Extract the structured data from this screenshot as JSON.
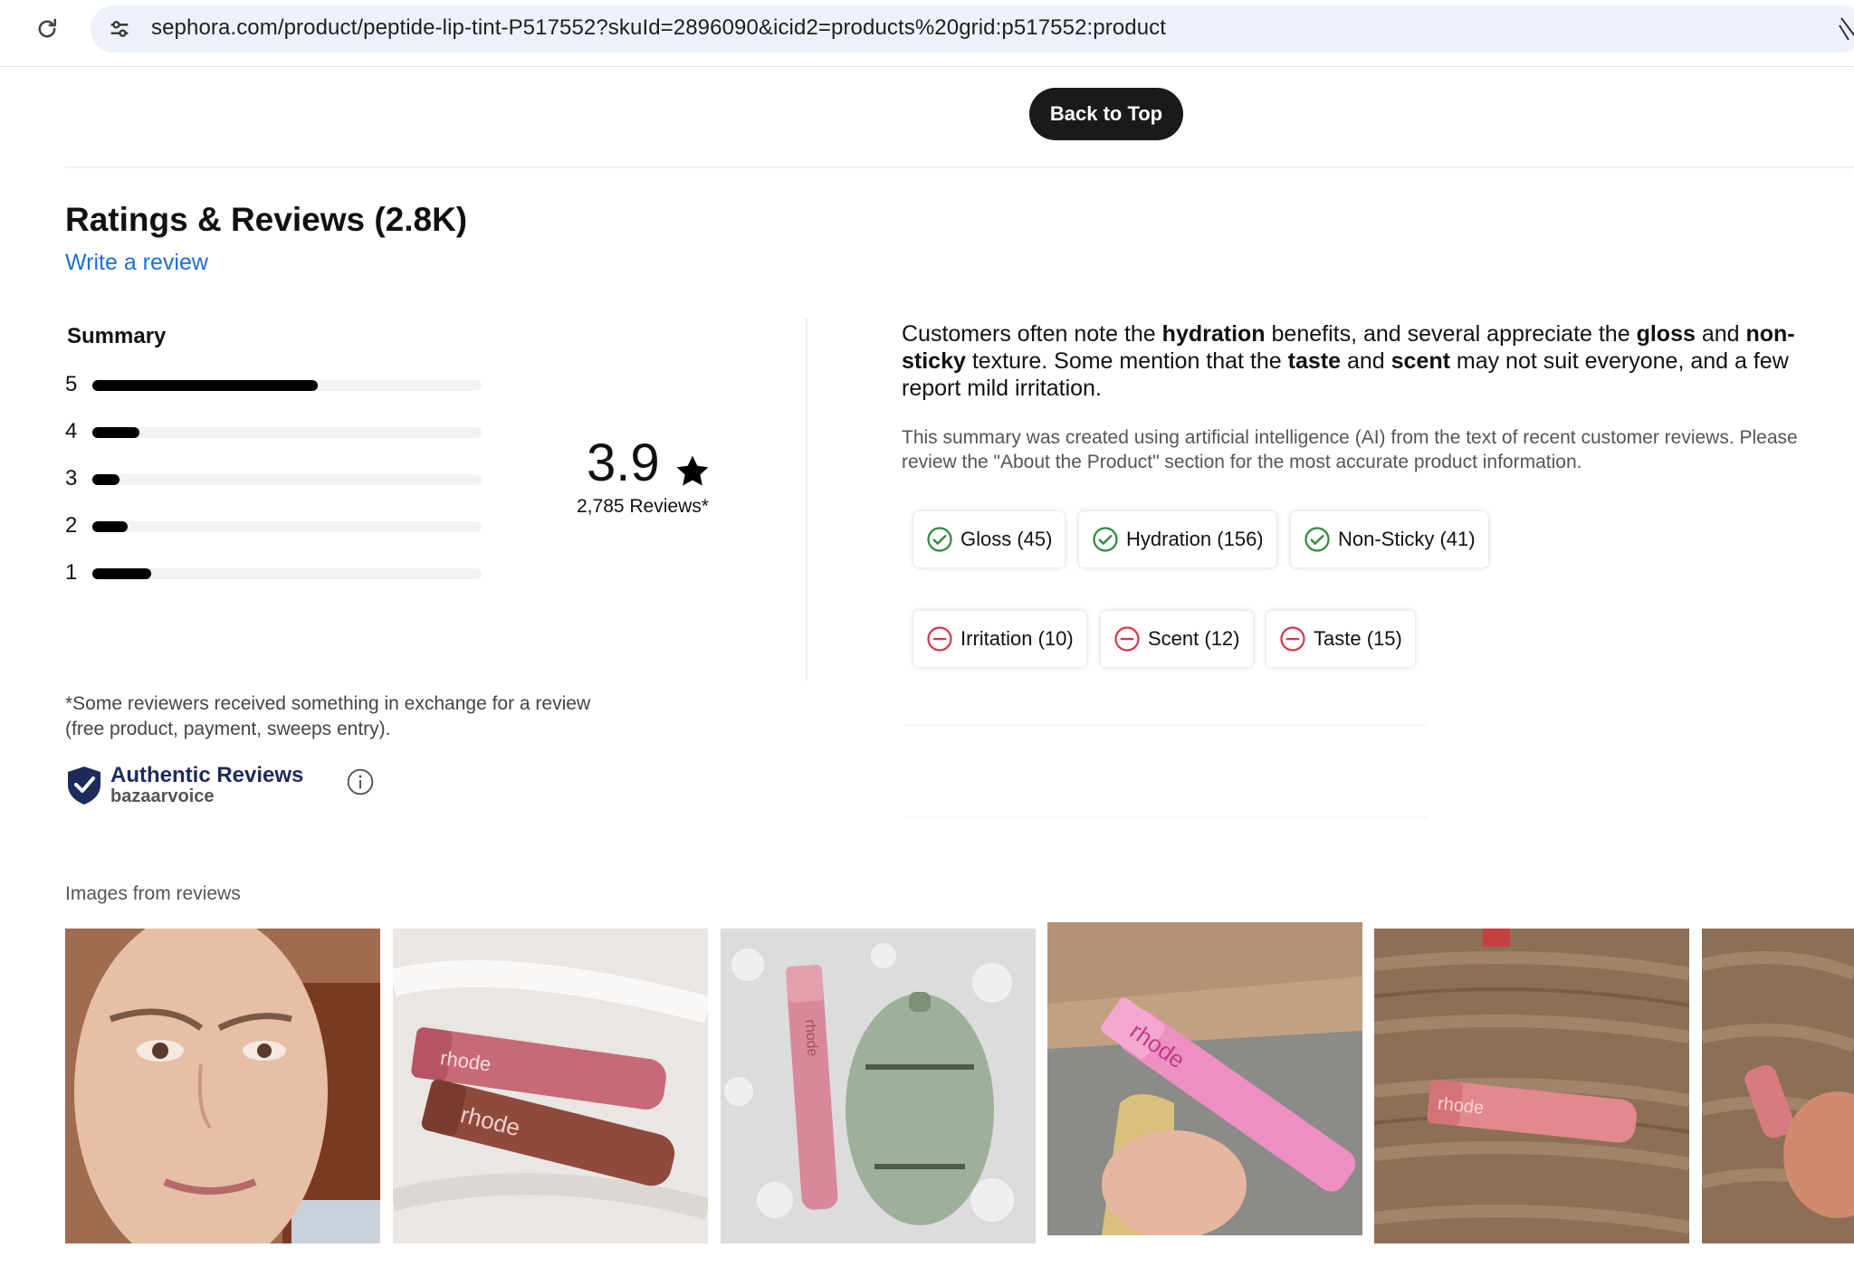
{
  "browser": {
    "url": "sephora.com/product/peptide-lip-tint-P517552?skuId=2896090&icid2=products%20grid:p517552:product"
  },
  "back_to_top": "Back to Top",
  "reviews": {
    "title": "Ratings & Reviews (2.8K)",
    "write_review": "Write a review",
    "summary_label": "Summary",
    "histogram": [
      {
        "stars": "5",
        "fraction": 0.58
      },
      {
        "stars": "4",
        "fraction": 0.12
      },
      {
        "stars": "3",
        "fraction": 0.07
      },
      {
        "stars": "2",
        "fraction": 0.09
      },
      {
        "stars": "1",
        "fraction": 0.15
      }
    ],
    "average": "3.9",
    "count_text": "2,785 Reviews*",
    "ai_summary_segments": [
      {
        "text": "Customers often note the ",
        "bold": false
      },
      {
        "text": "hydration",
        "bold": true
      },
      {
        "text": " benefits, and several appreciate the ",
        "bold": false
      },
      {
        "text": "gloss",
        "bold": true
      },
      {
        "text": " and ",
        "bold": false
      },
      {
        "text": "non-sticky",
        "bold": true
      },
      {
        "text": " texture. Some mention that the ",
        "bold": false
      },
      {
        "text": "taste",
        "bold": true
      },
      {
        "text": " and ",
        "bold": false
      },
      {
        "text": "scent",
        "bold": true
      },
      {
        "text": " may not suit everyone, and a few report mild irritation.",
        "bold": false
      }
    ],
    "ai_disclaimer": "This summary was created using artificial intelligence (AI) from the text of recent customer reviews. Please review the \"About the Product\" section for the most accurate product information.",
    "positive_tags": [
      {
        "label": "Gloss (45)",
        "icon": "check-circle-icon"
      },
      {
        "label": "Hydration (156)",
        "icon": "check-circle-icon"
      },
      {
        "label": "Non-Sticky (41)",
        "icon": "check-circle-icon"
      }
    ],
    "negative_tags": [
      {
        "label": "Irritation (10)",
        "icon": "minus-circle-icon"
      },
      {
        "label": "Scent (12)",
        "icon": "minus-circle-icon"
      },
      {
        "label": "Taste (15)",
        "icon": "minus-circle-icon"
      }
    ],
    "incentive_disclaimer_1": "*Some reviewers received something in exchange for a review",
    "incentive_disclaimer_2": "(free product, payment, sweeps entry).",
    "authentic_title": "Authentic Reviews",
    "authentic_sub": "bazaarvoice",
    "images_label": "Images from reviews",
    "review_images": [
      {
        "name": "review-image-selfie",
        "brand": ""
      },
      {
        "name": "review-image-two-tubes",
        "brand": "rhode"
      },
      {
        "name": "review-image-tube-and-case",
        "brand": "rhode"
      },
      {
        "name": "review-image-hand-tube",
        "brand": "rhode"
      },
      {
        "name": "review-image-tube-on-blanket",
        "brand": "rhode"
      },
      {
        "name": "review-image-partial",
        "brand": ""
      }
    ]
  },
  "colors": {
    "link": "#1b6fd6",
    "positive": "#2e8b3e",
    "negative": "#d6374e",
    "bar_fill": "#000000",
    "bar_track": "#f2f2f2"
  }
}
